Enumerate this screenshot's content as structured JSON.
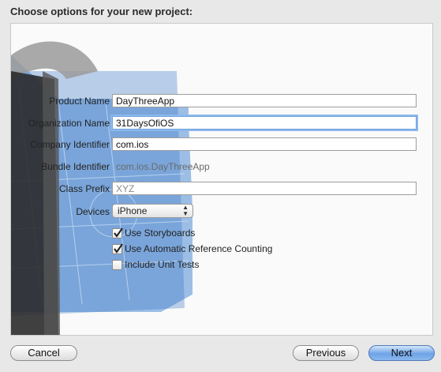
{
  "dialog": {
    "title": "Choose options for your new project:"
  },
  "form": {
    "product_name_label": "Product Name",
    "product_name_value": "DayThreeApp",
    "organization_name_label": "Organization Name",
    "organization_name_value": "31DaysOfiOS",
    "company_identifier_label": "Company Identifier",
    "company_identifier_value": "com.ios",
    "bundle_identifier_label": "Bundle Identifier",
    "bundle_identifier_value": "com.ios.DayThreeApp",
    "class_prefix_label": "Class Prefix",
    "class_prefix_placeholder": "XYZ",
    "devices_label": "Devices",
    "devices_value": "iPhone"
  },
  "options": [
    {
      "label": "Use Storyboards",
      "checked": true
    },
    {
      "label": "Use Automatic Reference Counting",
      "checked": true
    },
    {
      "label": "Include Unit Tests",
      "checked": false
    }
  ],
  "buttons": {
    "cancel": "Cancel",
    "previous": "Previous",
    "next": "Next"
  },
  "icons": {
    "background": "xcode-hammer-blueprint-icon",
    "devices_popup": "popup-arrows-icon",
    "checkmark": "checkmark-icon"
  },
  "colors": {
    "accent": "#6ea3e6",
    "focus_ring": "#8db8ec"
  }
}
